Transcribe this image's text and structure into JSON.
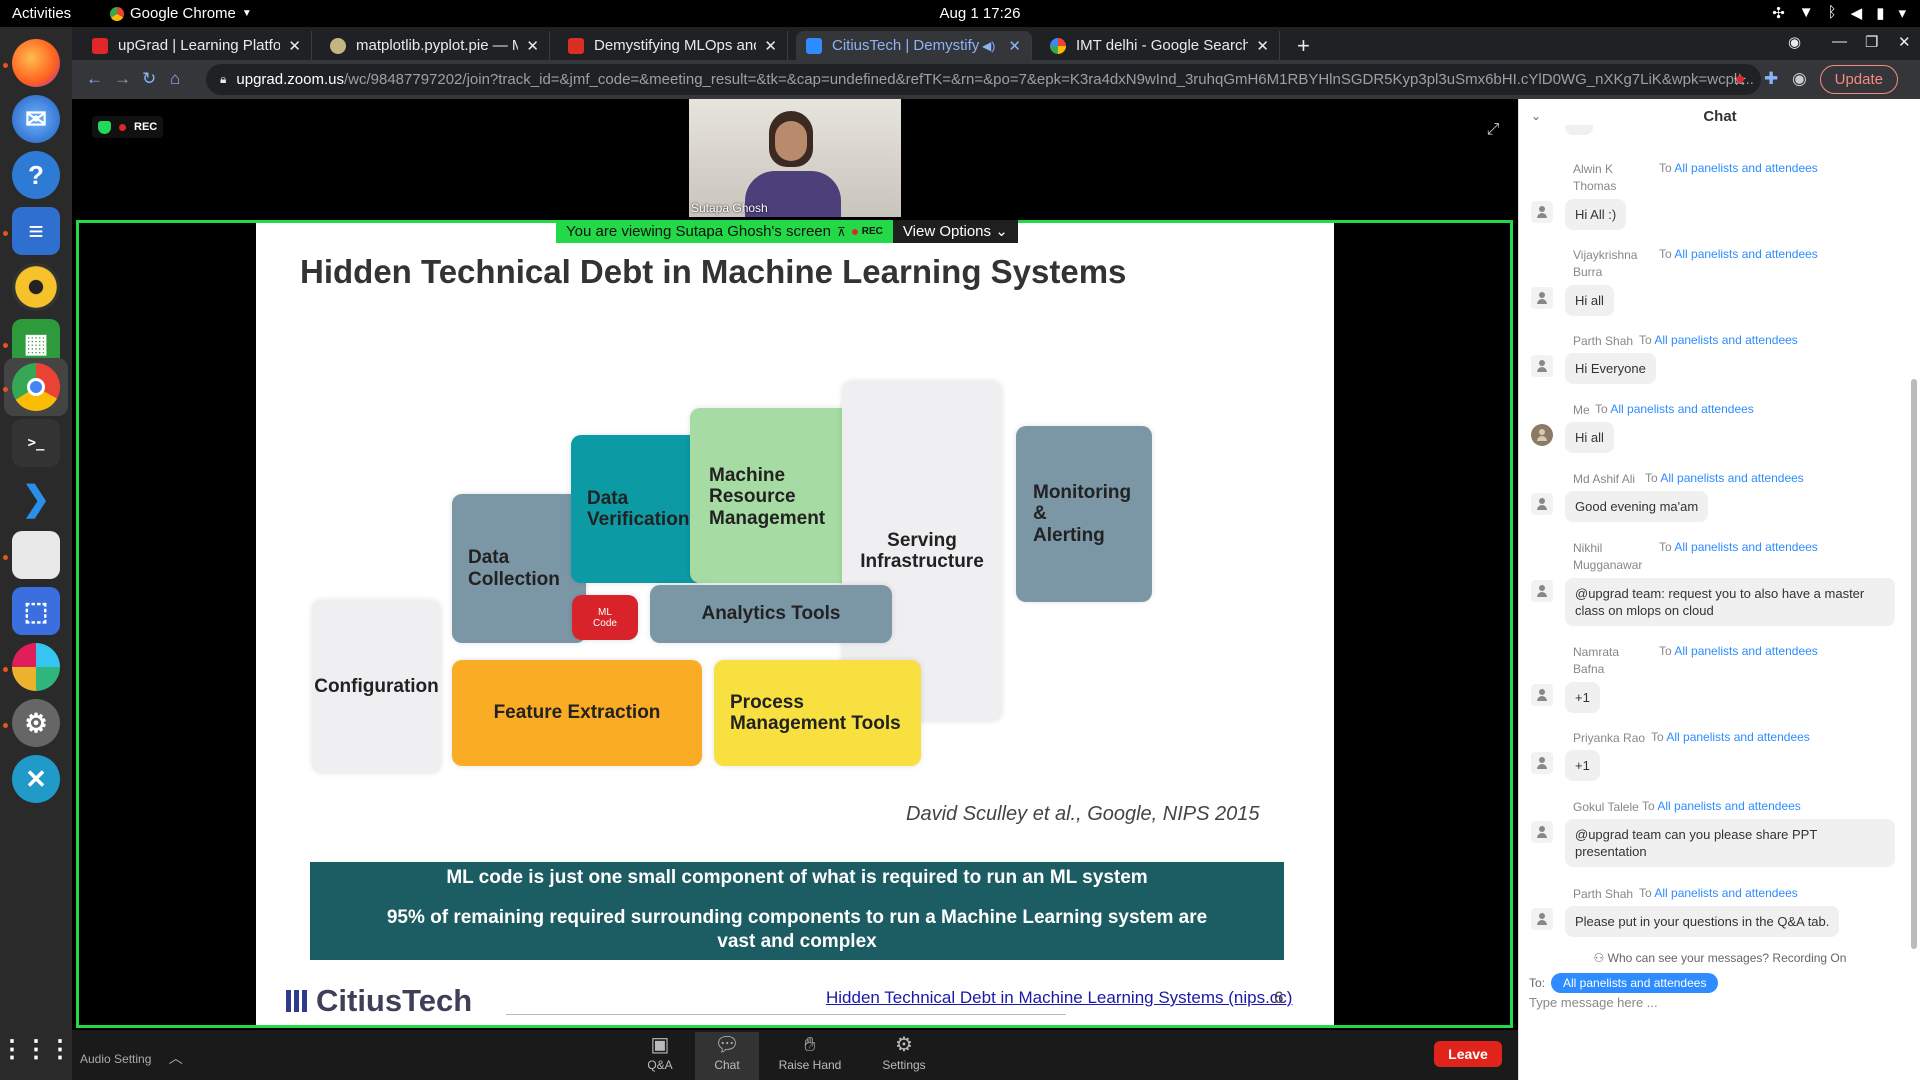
{
  "system": {
    "activities": "Activities",
    "app_name": "Google Chrome",
    "clock": "Aug 1  17:26"
  },
  "dock": {
    "items": [
      "firefox-icon",
      "thunderbird-icon",
      "help-icon",
      "writer-icon",
      "rhythmbox-icon",
      "calc-icon",
      "chrome-icon",
      "terminal-icon",
      "vscode-icon",
      "files-icon",
      "screenshot-icon",
      "slack-icon",
      "settings-icon",
      "remote-icon",
      "app-grid-icon"
    ]
  },
  "browser": {
    "tabs": [
      {
        "title": "upGrad | Learning Platfor",
        "color": "#e02828"
      },
      {
        "title": "matplotlib.pyplot.pie — M",
        "color": "#b0a070"
      },
      {
        "title": "Demystifying MLOps and",
        "color": "#d93025"
      },
      {
        "title": "CitiusTech | Demystify",
        "color": "#2d8cff"
      },
      {
        "title": "IMT delhi - Google Search",
        "color": "#4285f4"
      }
    ],
    "url_host": "upgrad.zoom.us",
    "url_path": "/wc/98487797202/join?track_id=&jmf_code=&meeting_result=&tk=&cap=undefined&refTK=&rn=&po=7&epk=K3ra4dxN9wInd_3ruhqGmH6M1RBYHlnSGDR5Kyp3pl3uSmx6bHI.cYlD0WG_nXKg7LiK&wpk=wcpk...",
    "update_label": "Update"
  },
  "meeting": {
    "rec_label": "REC",
    "presenter_name": "Sutapa Ghosh",
    "viewing_text": "You are viewing Sutapa Ghosh's screen",
    "view_options": "View Options"
  },
  "slide": {
    "title": "Hidden Technical Debt in Machine Learning Systems",
    "blocks": {
      "configuration": "Configuration",
      "data_collection": [
        "Data",
        "Collection"
      ],
      "data_verification": [
        "Data",
        "Verification"
      ],
      "machine_resource": [
        "Machine",
        "Resource",
        "Management"
      ],
      "serving": [
        "Serving",
        "Infrastructure"
      ],
      "monitoring": [
        "Monitoring",
        "&",
        "Alerting"
      ],
      "ml_code": [
        "ML",
        "Code"
      ],
      "analytics": "Analytics Tools",
      "feature_extraction": "Feature Extraction",
      "process_mgmt": [
        "Process",
        "Management Tools"
      ]
    },
    "citation": "David Sculley et al., Google, NIPS 2015",
    "banner_line1": "ML code is just one small component of what is required to run an ML system",
    "banner_line2": "95% of remaining required surrounding components to run a  Machine Learning system are vast and complex",
    "logo": "CitiusTech",
    "link": "Hidden Technical Debt in Machine Learning Systems (nips.cc)",
    "page": "6"
  },
  "bottom_bar": {
    "audio_setting": "Audio Setting",
    "qa": "Q&A",
    "chat": "Chat",
    "raise_hand": "Raise Hand",
    "settings": "Settings",
    "leave": "Leave"
  },
  "chat": {
    "title": "Chat",
    "to_label": "To",
    "messages": [
      {
        "sender": "Alwin K Thomas",
        "to": "All panelists and attendees",
        "text": "Hi All :)"
      },
      {
        "sender": "Vijaykrishna Burra",
        "to": "All panelists and attendees",
        "text": "Hi all"
      },
      {
        "sender": "Parth Shah",
        "to": "All panelists and attendees",
        "text": "Hi Everyone"
      },
      {
        "sender": "Me",
        "to": "All panelists and attendees",
        "text": "Hi all"
      },
      {
        "sender": "Md Ashif Ali",
        "to": "All panelists and attendees",
        "text": "Good evening ma'am"
      },
      {
        "sender": "Nikhil Mugganawar",
        "to": "All panelists and attendees",
        "text": "@upgrad team: request you to also have a master class on mlops on cloud"
      },
      {
        "sender": "Namrata Bafna",
        "to": "All panelists and attendees",
        "text": "+1"
      },
      {
        "sender": "Priyanka Rao",
        "to": "All panelists and attendees",
        "text": "+1"
      },
      {
        "sender": "Gokul Talele",
        "to": "All panelists and attendees",
        "text": "@upgrad team can you please share PPT presentation"
      },
      {
        "sender": "Parth Shah",
        "to": "All panelists and attendees",
        "text": "Please put in your questions in the Q&A tab."
      }
    ],
    "visibility_info": "Who can see your messages? Recording On",
    "to_prefix": "To:",
    "recipient": "All panelists and attendees",
    "input_placeholder": "Type message here ..."
  }
}
